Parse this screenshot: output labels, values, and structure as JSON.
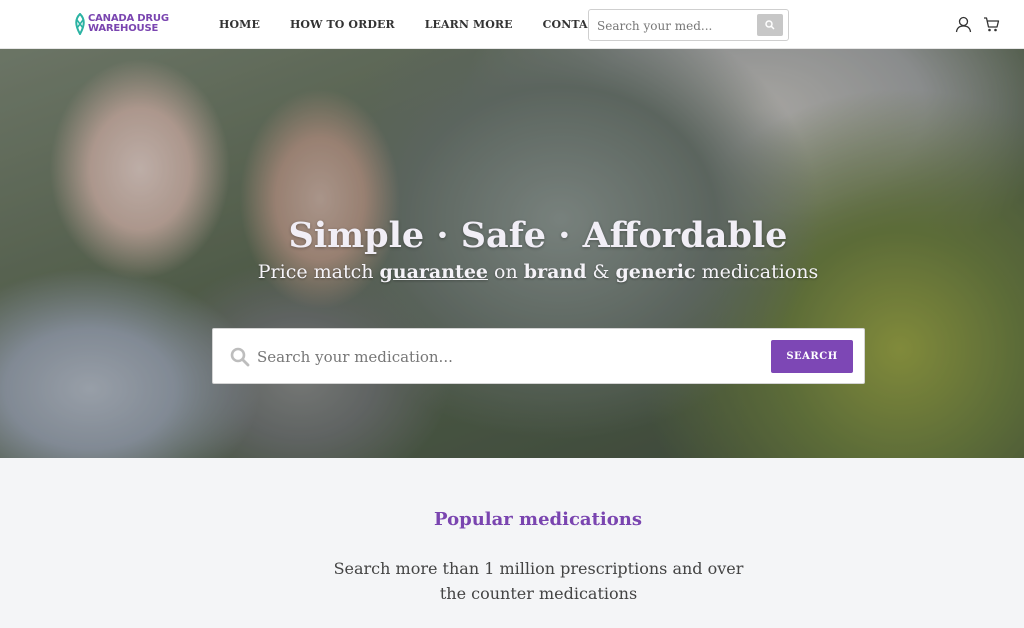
{
  "header": {
    "logo": {
      "line1": "CANADA DRUG",
      "line2": "WAREHOUSE"
    },
    "nav": [
      {
        "label": "HOME"
      },
      {
        "label": "HOW TO ORDER"
      },
      {
        "label": "LEARN MORE"
      },
      {
        "label": "CONTACT US"
      }
    ],
    "search": {
      "placeholder": "Search your med..."
    },
    "icons": {
      "account": "user-icon",
      "cart": "cart-icon",
      "search": "search-icon"
    }
  },
  "hero": {
    "title": "Simple · Safe · Affordable",
    "subtitle": {
      "part1": "Price match ",
      "guarantee": "guarantee",
      "part2": " on ",
      "brand": "brand",
      "part3": " & ",
      "generic": "generic",
      "part4": " medications"
    },
    "search": {
      "placeholder": "Search your medication...",
      "button_label": "SEARCH"
    }
  },
  "popular": {
    "title": "Popular medications",
    "description": "Search more than 1 million prescriptions and over the counter medications"
  },
  "colors": {
    "accent": "#7d47b5",
    "background": "#f4f5f7",
    "header_bg": "#ffffff"
  }
}
